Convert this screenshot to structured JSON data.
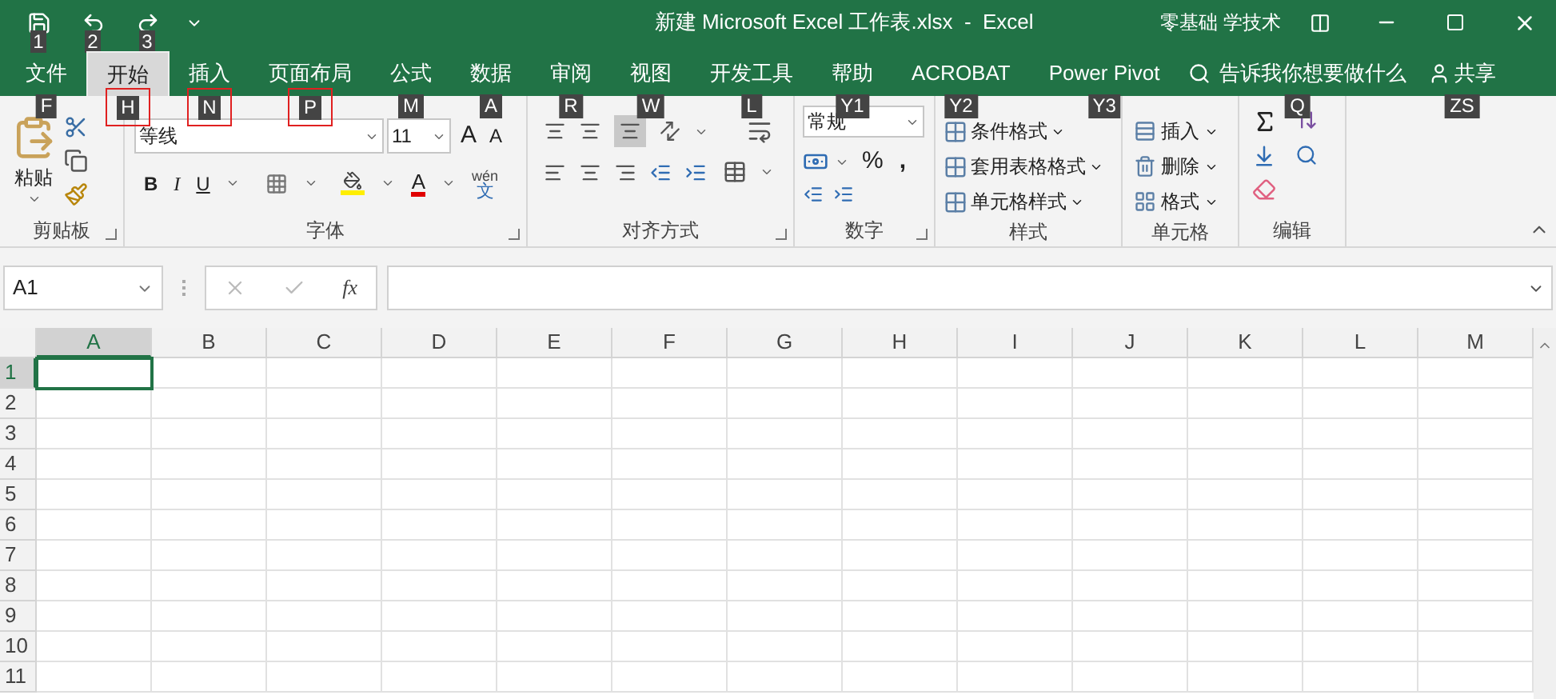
{
  "quick_access": {
    "key_tips": [
      "1",
      "2",
      "3"
    ]
  },
  "title_bar": {
    "title": "新建 Microsoft Excel 工作表.xlsx  -  Excel",
    "user": "零基础 学技术"
  },
  "tabs": [
    {
      "label": "文件",
      "selected": false,
      "key_tip": "F",
      "highlighted": false
    },
    {
      "label": "开始",
      "selected": true,
      "key_tip": "H",
      "highlighted": true
    },
    {
      "label": "插入",
      "selected": false,
      "key_tip": "N",
      "highlighted": true
    },
    {
      "label": "页面布局",
      "selected": false,
      "key_tip": "P",
      "highlighted": true
    },
    {
      "label": "公式",
      "selected": false,
      "key_tip": "M",
      "highlighted": false
    },
    {
      "label": "数据",
      "selected": false,
      "key_tip": "A",
      "highlighted": false
    },
    {
      "label": "审阅",
      "selected": false,
      "key_tip": "R",
      "highlighted": false
    },
    {
      "label": "视图",
      "selected": false,
      "key_tip": "W",
      "highlighted": false
    },
    {
      "label": "开发工具",
      "selected": false,
      "key_tip": "L",
      "highlighted": false
    },
    {
      "label": "帮助",
      "selected": false,
      "key_tip": "Y1",
      "highlighted": false
    },
    {
      "label": "ACROBAT",
      "selected": false,
      "key_tip": "Y2",
      "highlighted": false
    },
    {
      "label": "Power Pivot",
      "selected": false,
      "key_tip": "Y3",
      "highlighted": false
    }
  ],
  "tell_me": {
    "placeholder": "告诉我你想要做什么",
    "key_tip": "Q"
  },
  "share": {
    "label": "共享",
    "key_tip": "ZS"
  },
  "ribbon": {
    "clipboard": {
      "paste": "粘贴",
      "label": "剪贴板"
    },
    "font": {
      "font_name": "等线",
      "font_size": "11",
      "grow": "A",
      "shrink": "A",
      "font_color": "A",
      "bold": "B",
      "italic": "I",
      "underline": "U",
      "pinyin": "wén",
      "pinyin_char": "文",
      "label": "字体"
    },
    "alignment": {
      "label": "对齐方式"
    },
    "number": {
      "format": "常规",
      "percent": "%",
      "comma": ",",
      "label": "数字"
    },
    "styles": {
      "buttons": [
        "条件格式",
        "套用表格格式",
        "单元格样式"
      ],
      "label": "样式"
    },
    "cells": {
      "buttons": [
        "插入",
        "删除",
        "格式"
      ],
      "label": "单元格"
    },
    "editing": {
      "label": "编辑"
    }
  },
  "formula_bar": {
    "name_box": "A1",
    "fx": "fx"
  },
  "sheet": {
    "columns": [
      {
        "label": "A",
        "selected": true
      },
      {
        "label": "B",
        "selected": false
      },
      {
        "label": "C",
        "selected": false
      },
      {
        "label": "D",
        "selected": false
      },
      {
        "label": "E",
        "selected": false
      },
      {
        "label": "F",
        "selected": false
      },
      {
        "label": "G",
        "selected": false
      },
      {
        "label": "H",
        "selected": false
      },
      {
        "label": "I",
        "selected": false
      },
      {
        "label": "J",
        "selected": false
      },
      {
        "label": "K",
        "selected": false
      },
      {
        "label": "L",
        "selected": false
      },
      {
        "label": "M",
        "selected": false
      }
    ],
    "rows": [
      {
        "label": "1",
        "selected": true
      },
      {
        "label": "2",
        "selected": false
      },
      {
        "label": "3",
        "selected": false
      },
      {
        "label": "4",
        "selected": false
      },
      {
        "label": "5",
        "selected": false
      },
      {
        "label": "6",
        "selected": false
      },
      {
        "label": "7",
        "selected": false
      },
      {
        "label": "8",
        "selected": false
      },
      {
        "label": "9",
        "selected": false
      },
      {
        "label": "10",
        "selected": false
      },
      {
        "label": "11",
        "selected": false
      }
    ]
  }
}
